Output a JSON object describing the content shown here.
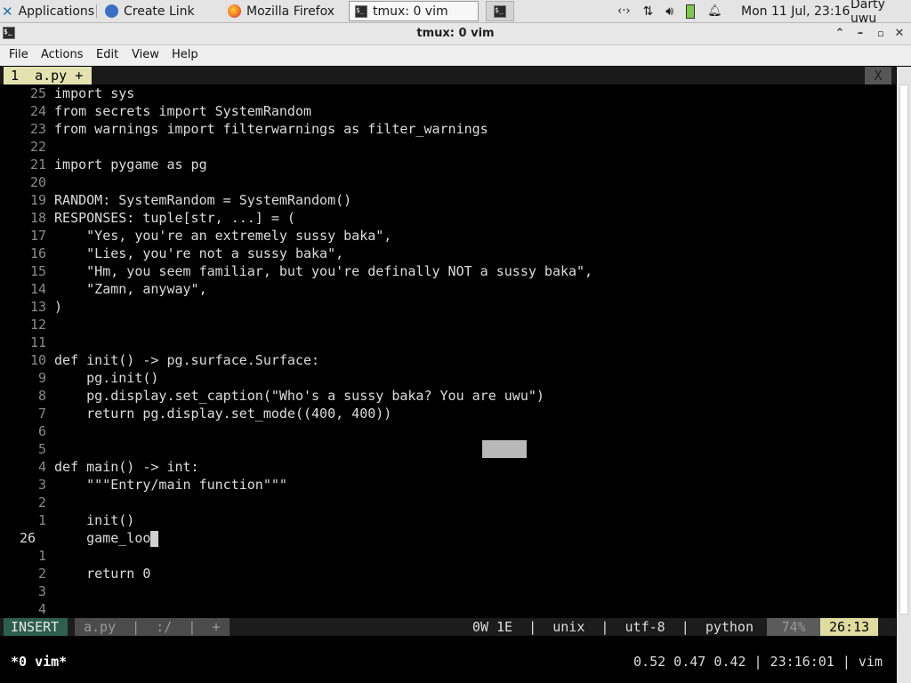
{
  "panel": {
    "applications": "Applications",
    "tasks": [
      {
        "label": "Create Link",
        "icon": "globe-icon"
      },
      {
        "label": "Mozilla Firefox",
        "icon": "firefox-icon"
      },
      {
        "label": "tmux: 0 vim",
        "icon": "terminal-icon"
      }
    ],
    "clock": "Mon 11 Jul, 23:16",
    "user": "Darty uwu"
  },
  "window": {
    "title": "tmux: 0 vim"
  },
  "menu": [
    "File",
    "Actions",
    "Edit",
    "View",
    "Help"
  ],
  "vim": {
    "tab_label": "1  a.py +",
    "close_label": "X",
    "lines": [
      {
        "n": "25",
        "t": "import sys"
      },
      {
        "n": "24",
        "t": "from secrets import SystemRandom"
      },
      {
        "n": "23",
        "t": "from warnings import filterwarnings as filter_warnings"
      },
      {
        "n": "22",
        "t": ""
      },
      {
        "n": "21",
        "t": "import pygame as pg"
      },
      {
        "n": "20",
        "t": ""
      },
      {
        "n": "19",
        "t": "RANDOM: SystemRandom = SystemRandom()"
      },
      {
        "n": "18",
        "t": "RESPONSES: tuple[str, ...] = ("
      },
      {
        "n": "17",
        "t": "    \"Yes, you're an extremely sussy baka\","
      },
      {
        "n": "16",
        "t": "    \"Lies, you're not a sussy baka\","
      },
      {
        "n": "15",
        "t": "    \"Hm, you seem familiar, but you're definally NOT a sussy baka\","
      },
      {
        "n": "14",
        "t": "    \"Zamn, anyway\","
      },
      {
        "n": "13",
        "t": ")"
      },
      {
        "n": "12",
        "t": ""
      },
      {
        "n": "11",
        "t": ""
      },
      {
        "n": "10",
        "t": "def init() -> pg.surface.Surface:"
      },
      {
        "n": "9",
        "t": "    pg.init()"
      },
      {
        "n": "8",
        "t": "    pg.display.set_caption(\"Who's a sussy baka? You are uwu\")"
      },
      {
        "n": "7",
        "t": "    return pg.display.set_mode((400, 400))"
      },
      {
        "n": "6",
        "t": ""
      },
      {
        "n": "5",
        "t": ""
      },
      {
        "n": "4",
        "t": "def main() -> int:"
      },
      {
        "n": "3",
        "t": "    \"\"\"Entry/main function\"\"\""
      },
      {
        "n": "2",
        "t": ""
      },
      {
        "n": "1",
        "t": "    init()"
      },
      {
        "n": "26",
        "t": "    game_loo",
        "current": true
      },
      {
        "n": "1",
        "t": ""
      },
      {
        "n": "2",
        "t": "    return 0"
      },
      {
        "n": "3",
        "t": ""
      },
      {
        "n": "4",
        "t": ""
      }
    ],
    "status": {
      "mode": "INSERT",
      "file": "a.py  |  :/  |  +",
      "info": "0W 1E  |  unix  |  utf-8  |  python",
      "percent": "74%",
      "position": "26:13"
    }
  },
  "tmux": {
    "left": "*0 vim*",
    "right": "0.52 0.47 0.42 | 23:16:01 | vim"
  }
}
